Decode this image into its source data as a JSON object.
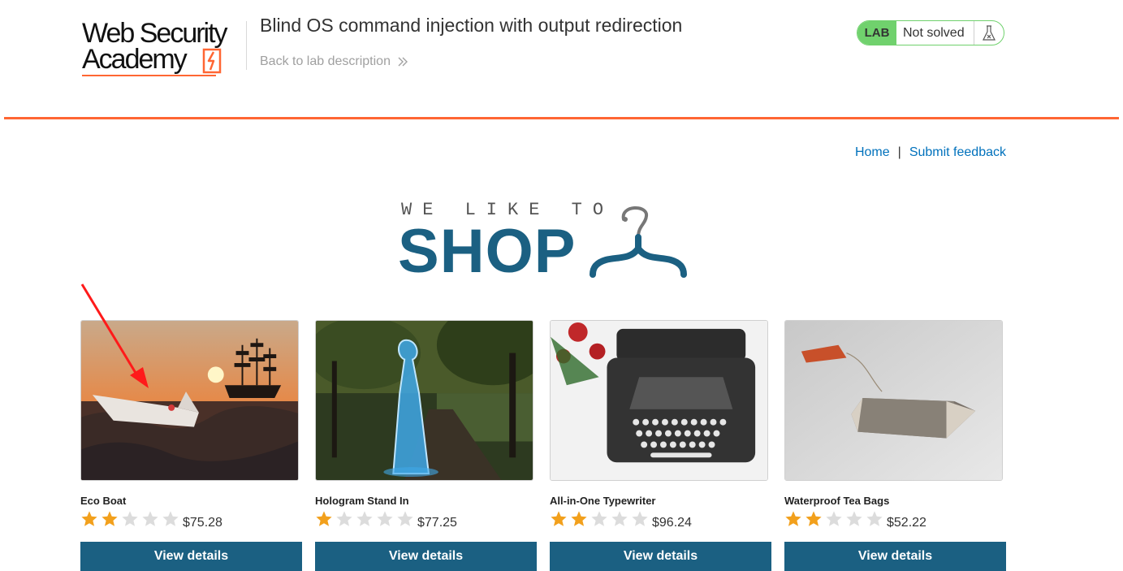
{
  "header": {
    "logo_line1": "Web Security",
    "logo_line2": "Academy",
    "lab_title": "Blind OS command injection with output redirection",
    "back_link": "Back to lab description",
    "lab_badge": {
      "tag": "LAB",
      "status": "Not solved"
    }
  },
  "nav": {
    "home": "Home",
    "separator": "|",
    "submit_feedback": "Submit feedback"
  },
  "hero": {
    "tagline": "WE LIKE TO",
    "brand": "SHOP"
  },
  "colors": {
    "accent_orange": "#ff6633",
    "brand_blue": "#1b6082",
    "link_blue": "#0071bc",
    "lab_green": "#70d16d",
    "star_gold": "#f2a01c",
    "star_empty": "#dcdcdc"
  },
  "products": [
    {
      "name": "Eco Boat",
      "rating": 2,
      "price": "$75.28",
      "button": "View details",
      "image": "paper-boat-sunset"
    },
    {
      "name": "Hologram Stand In",
      "rating": 1,
      "price": "$77.25",
      "button": "View details",
      "image": "hologram-woman-park"
    },
    {
      "name": "All-in-One Typewriter",
      "rating": 2,
      "price": "$96.24",
      "button": "View details",
      "image": "typewriter-roses"
    },
    {
      "name": "Waterproof Tea Bags",
      "rating": 2,
      "price": "$52.22",
      "button": "View details",
      "image": "tea-bag"
    }
  ]
}
